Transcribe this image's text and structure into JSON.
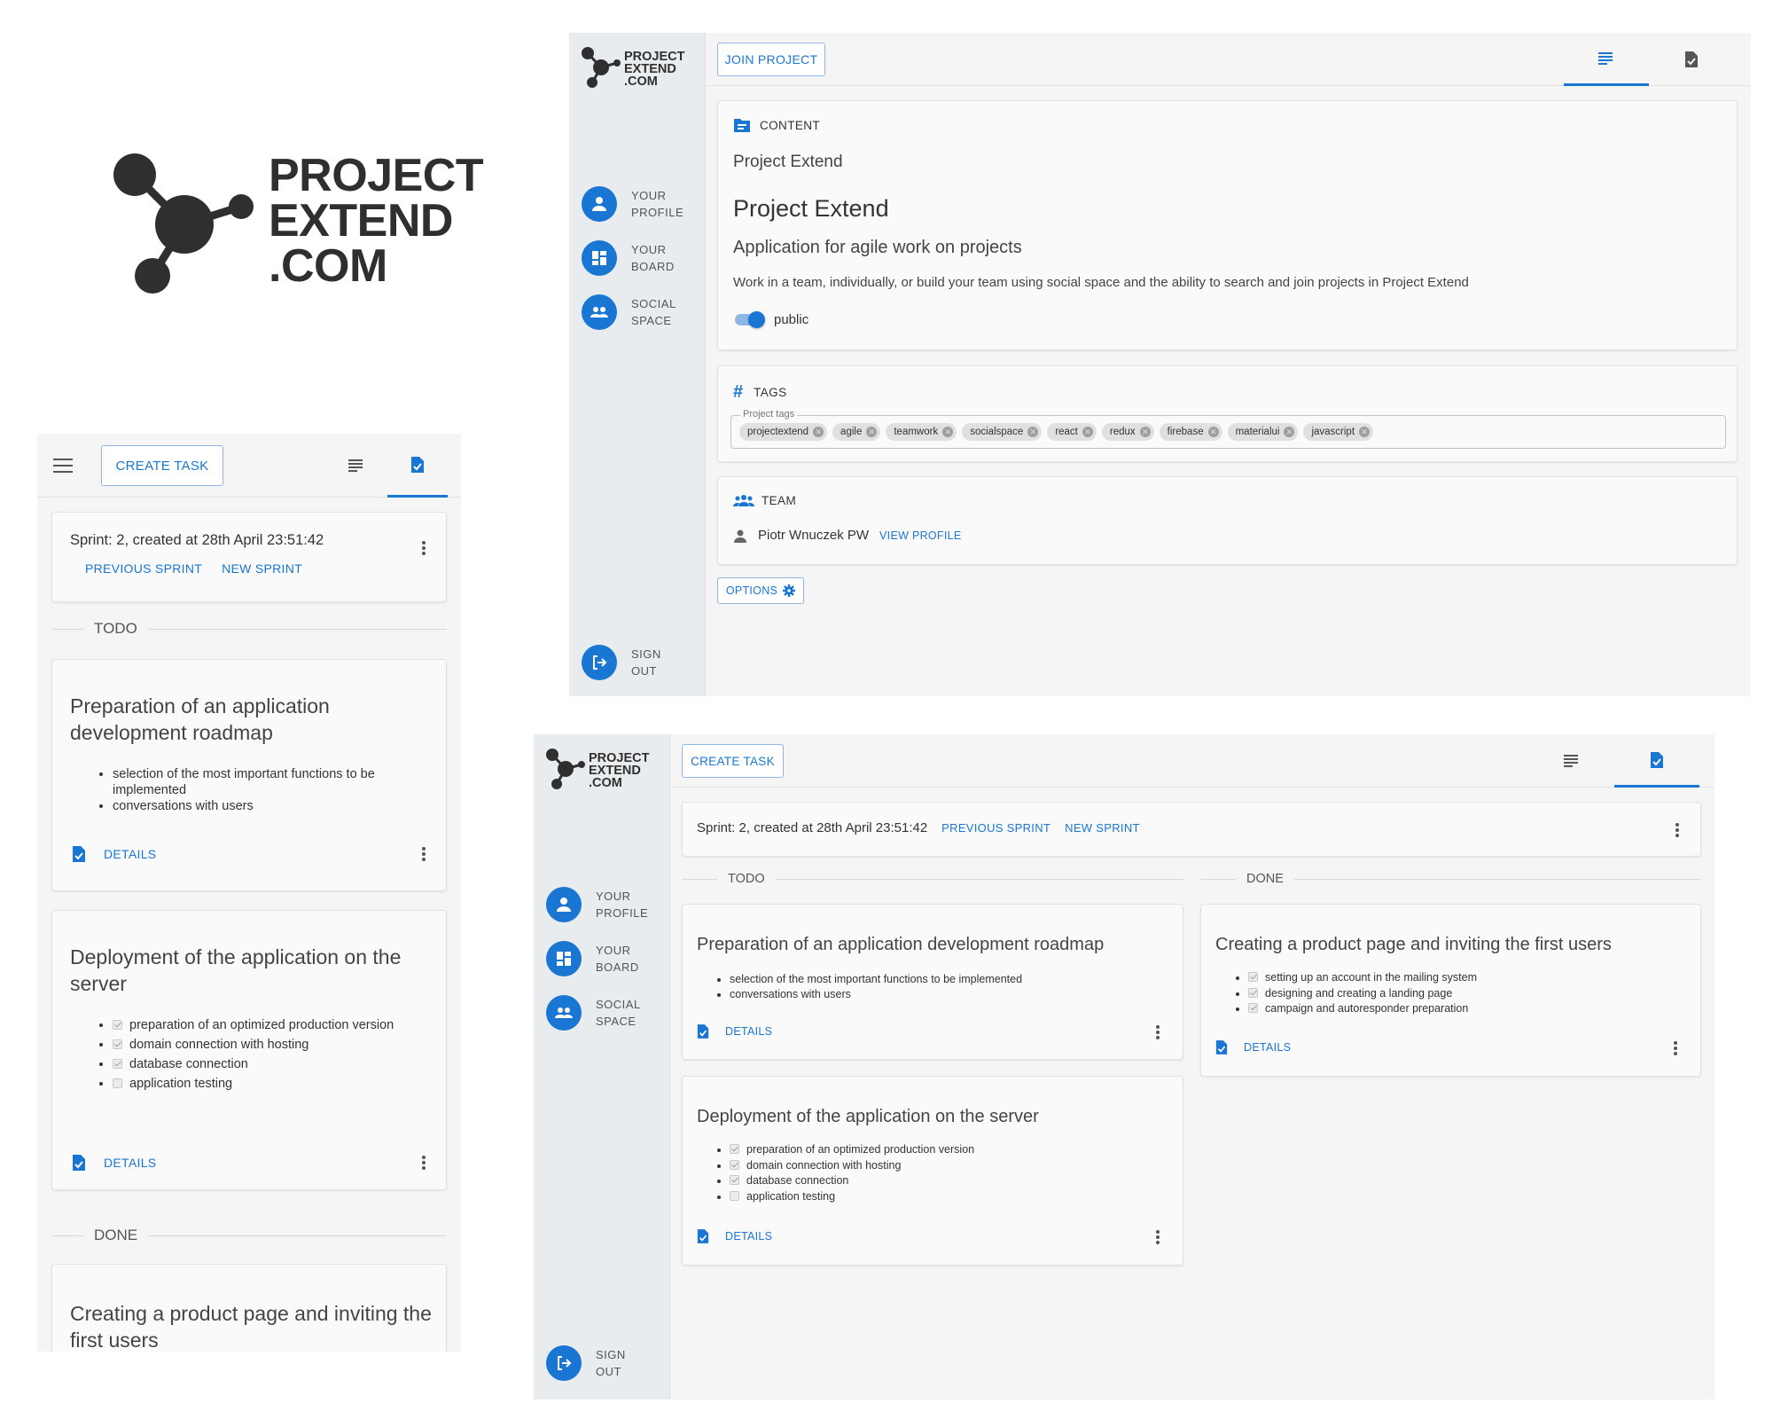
{
  "brand": {
    "line1": "PROJECT",
    "line2": "EXTEND",
    "line3": ".COM"
  },
  "sidebar": {
    "items": [
      {
        "line1": "YOUR",
        "line2": "PROFILE",
        "icon": "person-icon"
      },
      {
        "line1": "YOUR",
        "line2": "BOARD",
        "icon": "dashboard-icon"
      },
      {
        "line1": "SOCIAL",
        "line2": "SPACE",
        "icon": "people-icon"
      }
    ],
    "signout": {
      "line1": "SIGN",
      "line2": "OUT",
      "icon": "logout-icon"
    }
  },
  "project_view": {
    "join_button": "JOIN PROJECT",
    "content_header": "CONTENT",
    "project_name_small": "Project Extend",
    "project_name": "Project Extend",
    "subtitle": "Application for agile work on projects",
    "description": "Work in a team, individually, or build your team using social space and the ability to search and join projects in Project Extend",
    "public_label": "public",
    "public_enabled": true,
    "tags_header": "TAGS",
    "tags_field_label": "Project tags",
    "tags": [
      "projectextend",
      "agile",
      "teamwork",
      "socialspace",
      "react",
      "redux",
      "firebase",
      "materialui",
      "javascript"
    ],
    "team_header": "TEAM",
    "member_name": "Piotr Wnuczek PW",
    "view_profile": "VIEW PROFILE",
    "options_button": "OPTIONS"
  },
  "board": {
    "create_task": "CREATE TASK",
    "sprint_info": "Sprint: 2, created at 28th April 23:51:42",
    "previous_sprint": "PREVIOUS SPRINT",
    "new_sprint": "NEW SPRINT",
    "todo_label": "TODO",
    "done_label": "DONE",
    "details": "DETAILS",
    "task1": {
      "title": "Preparation of an application development roadmap",
      "items": [
        "selection of the most important functions to be implemented",
        "conversations with users"
      ]
    },
    "task2": {
      "title": "Deployment of the application on the server",
      "items": [
        {
          "text": "preparation of an optimized production version",
          "checked": true
        },
        {
          "text": "domain connection with hosting",
          "checked": true
        },
        {
          "text": "database connection",
          "checked": true
        },
        {
          "text": "application testing",
          "checked": false
        }
      ]
    },
    "task3": {
      "title": "Creating a product page and inviting the first users",
      "items": [
        {
          "text": "setting up an account in the mailing system",
          "checked": true
        },
        {
          "text": "designing and creating a landing page",
          "checked": true
        },
        {
          "text": "campaign and autoresponder preparation",
          "checked": true
        }
      ]
    }
  },
  "colors": {
    "accent": "#1976d2",
    "sidebar": "#e8ecef",
    "panel": "#f5f5f5",
    "logo": "#2f2f2f"
  }
}
